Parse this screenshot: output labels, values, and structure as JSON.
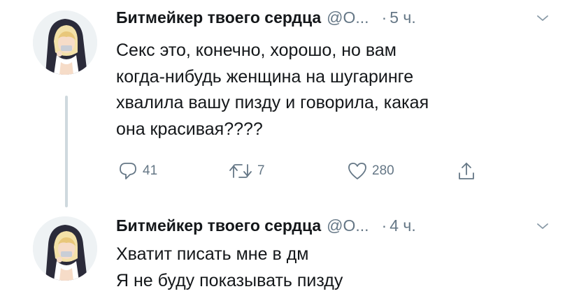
{
  "tweets": [
    {
      "display_name": "Битмейкер твоего сердца",
      "handle": "@О...",
      "separator": "·",
      "time": "5 ч.",
      "lines": [
        "Секс это, конечно, хорошо, но вам",
        "когда-нибудь женщина на шугаринге",
        "хвалила вашу пизду и говорила, какая",
        "она красивая????"
      ],
      "actions": {
        "replies": "41",
        "retweets": "7",
        "likes": "280"
      }
    },
    {
      "display_name": "Битмейкер твоего сердца",
      "handle": "@О...",
      "separator": "·",
      "time": "4 ч.",
      "lines": [
        "Хватит писать мне в дм",
        "Я не буду показывать пизду"
      ]
    }
  ],
  "icons": {
    "reply": "reply-icon",
    "retweet": "retweet-icon",
    "like": "heart-icon",
    "share": "share-icon",
    "more": "chevron-down-icon"
  },
  "colors": {
    "text_primary": "#14171a",
    "text_secondary": "#657786",
    "thread_line": "#cfd9de"
  }
}
